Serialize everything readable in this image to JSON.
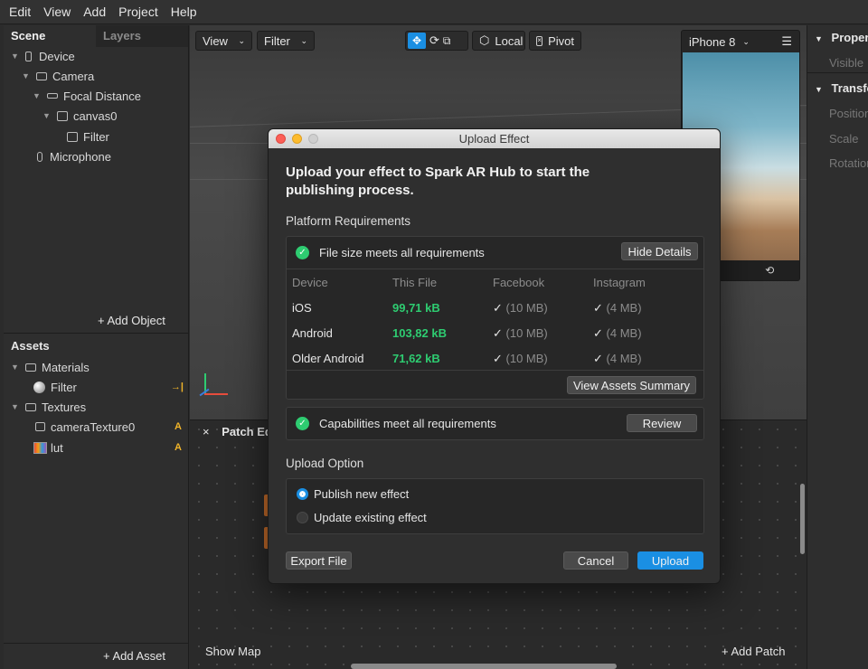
{
  "menubar": [
    "Edit",
    "View",
    "Add",
    "Project",
    "Help"
  ],
  "left": {
    "tabs": [
      "Scene",
      "Layers"
    ],
    "scene_tree": [
      {
        "label": "Device",
        "icon": "phone-icon",
        "indent": 0,
        "caret": true
      },
      {
        "label": "Camera",
        "icon": "camera-icon",
        "indent": 1,
        "caret": true
      },
      {
        "label": "Focal Distance",
        "icon": "ruler-icon",
        "indent": 2,
        "caret": true
      },
      {
        "label": "canvas0",
        "icon": "canvas-icon",
        "indent": 3,
        "caret": true
      },
      {
        "label": "Filter",
        "icon": "rect-icon",
        "indent": 4,
        "caret": false
      },
      {
        "label": "Microphone",
        "icon": "microphone-icon",
        "indent": 2,
        "caret": false
      }
    ],
    "add_object": "+ Add Object",
    "assets_title": "Assets",
    "assets": [
      {
        "label": "Materials",
        "icon": "folder-icon",
        "indent": 0,
        "caret": true,
        "badge": ""
      },
      {
        "label": "Filter",
        "icon": "sphere-icon",
        "indent": 1,
        "caret": false,
        "badge": "→|"
      },
      {
        "label": "Textures",
        "icon": "folder-icon",
        "indent": 0,
        "caret": true,
        "badge": ""
      },
      {
        "label": "cameraTexture0",
        "icon": "image-icon",
        "indent": 1,
        "caret": false,
        "badge": "A"
      },
      {
        "label": "lut",
        "icon": "lut-icon",
        "indent": 1,
        "caret": false,
        "badge": "A"
      }
    ],
    "add_asset": "+ Add Asset"
  },
  "viewport": {
    "view_menu": "View",
    "filter_menu": "Filter",
    "local_label": "Local",
    "pivot_label": "Pivot",
    "device_menu": "iPhone 8"
  },
  "right": {
    "properties_title": "Properties",
    "visible_label": "Visible",
    "transform_title": "Transform",
    "position_label": "Position",
    "scale_label": "Scale",
    "rotation_label": "Rotation"
  },
  "patch_editor": {
    "title": "Patch Editor",
    "show_map": "Show Map",
    "add_patch": "+ Add Patch"
  },
  "dialog": {
    "title": "Upload Effect",
    "heading": "Upload your effect to Spark AR Hub to start the publishing process.",
    "platform_requirements": "Platform Requirements",
    "file_size_status": "File size meets all requirements",
    "hide_details": "Hide Details",
    "columns": [
      "Device",
      "This File",
      "Facebook",
      "Instagram"
    ],
    "rows": [
      {
        "device": "iOS",
        "size": "99,71 kB",
        "facebook": "(10 MB)",
        "instagram": "(4 MB)"
      },
      {
        "device": "Android",
        "size": "103,82 kB",
        "facebook": "(10 MB)",
        "instagram": "(4 MB)"
      },
      {
        "device": "Older Android",
        "size": "71,62 kB",
        "facebook": "(10 MB)",
        "instagram": "(4 MB)"
      }
    ],
    "view_assets_summary": "View Assets Summary",
    "capabilities_status": "Capabilities meet all requirements",
    "review": "Review",
    "upload_option": "Upload Option",
    "options": [
      "Publish new effect",
      "Update existing effect"
    ],
    "selected_option": 0,
    "export_file": "Export File",
    "cancel": "Cancel",
    "upload": "Upload",
    "accent_color": "#1a8fe3",
    "success_color": "#2ecc71"
  }
}
